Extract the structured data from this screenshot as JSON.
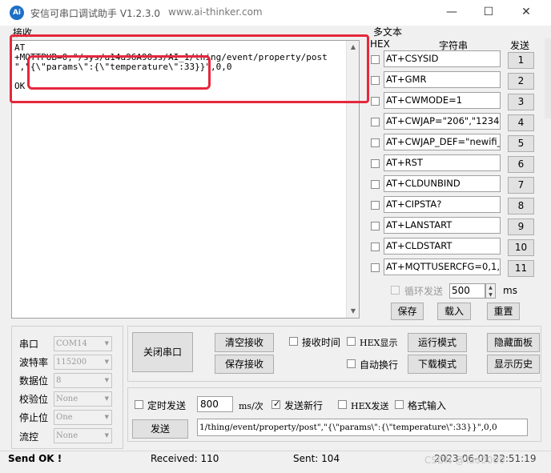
{
  "titlebar": {
    "icon_text": "Ai",
    "title": "安信可串口调试助手 V1.2.3.0",
    "url": "www.ai-thinker.com",
    "minimize": "—",
    "maximize": "☐",
    "close": "✕"
  },
  "receive": {
    "label": "接收",
    "content": "AT\n+MQTTPUB=0,\"/sys/a14a96A90ss/AI_1/thing/event/property/post\n\",\"{\\\"params\\\":{\\\"temperature\\\":33}}\",0,0\n\nOK"
  },
  "multitext": {
    "title": "多文本",
    "hex_header": "HEX",
    "string_header": "字符串",
    "send_header": "发送",
    "rows": [
      {
        "value": "AT+CSYSID",
        "button": "1"
      },
      {
        "value": "AT+GMR",
        "button": "2"
      },
      {
        "value": "AT+CWMODE=1",
        "button": "3"
      },
      {
        "value": "AT+CWJAP=\"206\",\"123456",
        "button": "4"
      },
      {
        "value": "AT+CWJAP_DEF=\"newifi_",
        "button": "5"
      },
      {
        "value": "AT+RST",
        "button": "6"
      },
      {
        "value": "AT+CLDUNBIND",
        "button": "7"
      },
      {
        "value": "AT+CIPSTA?",
        "button": "8"
      },
      {
        "value": "AT+LANSTART",
        "button": "9"
      },
      {
        "value": "AT+CLDSTART",
        "button": "10"
      },
      {
        "value": "AT+MQTTUSERCFG=0,1,\"",
        "button": "11"
      }
    ],
    "loop_label": "循环发送",
    "loop_ms": "500",
    "ms_unit": "ms",
    "save": "保存",
    "load": "载入",
    "reset": "重置"
  },
  "serial": {
    "port_label": "串口",
    "port_value": "COM14",
    "baud_label": "波特率",
    "baud_value": "115200",
    "databits_label": "数据位",
    "databits_value": "8",
    "parity_label": "校验位",
    "parity_value": "None",
    "stopbits_label": "停止位",
    "stopbits_value": "One",
    "flow_label": "流控",
    "flow_value": "None"
  },
  "controls": {
    "close_port": "关闭串口",
    "clear_recv": "清空接收",
    "save_recv": "保存接收",
    "recv_time": "接收时间",
    "hex_display": "HEX显示",
    "auto_newline": "自动换行",
    "run_mode": "运行模式",
    "download_mode": "下载模式",
    "hide_panel": "隐藏面板",
    "show_history": "显示历史"
  },
  "send": {
    "timed_send": "定时发送",
    "interval": "800",
    "interval_unit": "ms/次",
    "send_newline": "发送新行",
    "hex_send": "HEX发送",
    "format_input": "格式输入",
    "send_button": "发送",
    "send_content": "1/thing/event/property/post\",\"{\\\"params\\\":{\\\"temperature\\\":33}}\",0,0"
  },
  "status": {
    "send_ok": "Send OK !",
    "received": "Received: 110",
    "sent": "Sent: 104",
    "datetime": "2023-06-01 22:51:19",
    "watermark": "CSDN @Tao0000"
  }
}
